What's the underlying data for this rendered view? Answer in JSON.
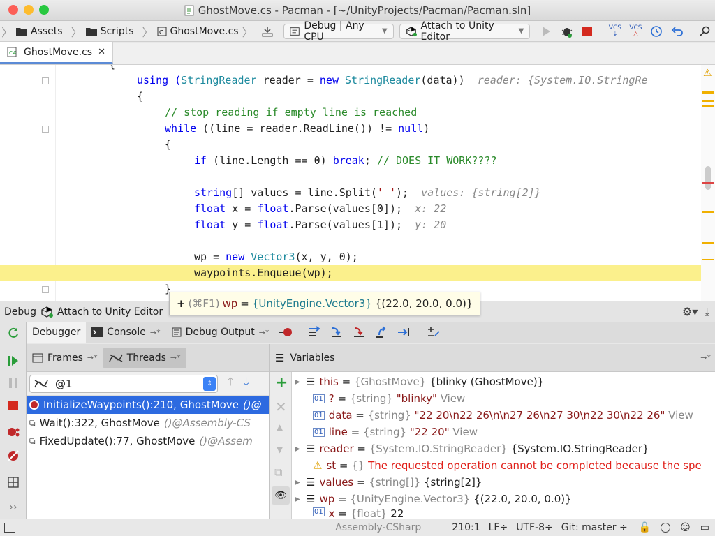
{
  "window": {
    "title": "GhostMove.cs - Pacman - [~/UnityProjects/Pacman/Pacman.sln]"
  },
  "toolbar": {
    "breadcrumbs": [
      "Assets",
      "Scripts",
      "GhostMove.cs"
    ],
    "config": "Debug | Any CPU",
    "attach": "Attach to Unity Editor",
    "vcs1": "VCS",
    "vcs2": "VCS"
  },
  "tab": {
    "label": "GhostMove.cs",
    "close": "✕"
  },
  "code": {
    "l0": "{",
    "l1a": "using (",
    "l1b": "StringReader",
    "l1c": " reader = ",
    "l1d": "new",
    "l1e": "StringReader",
    "l1f": "(data))",
    "l1hint": "reader: {System.IO.StringRe",
    "l2": "{",
    "l3": "// stop reading if empty line is reached",
    "l4a": "while",
    "l4b": " ((line = reader.ReadLine()) != ",
    "l4c": "null",
    "l4d": ")",
    "l5": "{",
    "l6a": "if",
    "l6b": " (line.Length == 0) ",
    "l6c": "break",
    "l6d": "; ",
    "l6e": "// DOES IT WORK????",
    "l7a": "string",
    "l7b": "[] values = line.Split(",
    "l7c": "' '",
    "l7d": ");",
    "l7hint": "values: {string[2]}",
    "l8a": "float",
    "l8b": " x = ",
    "l8c": "float",
    "l8d": ".Parse(values[0]);",
    "l8hint": "x: 22",
    "l9a": "float",
    "l9b": " y = ",
    "l9c": "float",
    "l9d": ".Parse(values[1]);",
    "l9hint": "y: 20",
    "l10a": "wp = ",
    "l10b": "new",
    "l10c": "Vector3",
    "l10d": "(x, y, 0);",
    "l11": "waypoints.Enqueue(wp);",
    "l12": "}"
  },
  "tooltip": {
    "plus": "+",
    "shortcut": "(⌘F1)",
    "name": "wp",
    "eq": "=",
    "type": "{UnityEngine.Vector3}",
    "value": "{(22.0, 20.0, 0.0)}"
  },
  "debugbar": {
    "label": "Debug",
    "session": "Attach to Unity Editor"
  },
  "dbgtabs": {
    "debugger": "Debugger",
    "console": "Console",
    "output": "Debug Output",
    "pin": "→*"
  },
  "frames": {
    "frames_tab": "Frames",
    "threads_tab": "Threads",
    "pin": "→*",
    "thread_select": "@1",
    "items": [
      {
        "method": "InitializeWaypoints():210, GhostMove",
        "asm": "()@"
      },
      {
        "method": "Wait():322, GhostMove",
        "asm": "()@Assembly-CS"
      },
      {
        "method": "FixedUpdate():77, GhostMove",
        "asm": "()@Assem"
      }
    ]
  },
  "variables": {
    "title": "Variables",
    "pin": "→*",
    "items": [
      {
        "name": "this",
        "eq": " = ",
        "type": "{GhostMove}",
        "value": " {blinky (GhostMove)}",
        "view": ""
      },
      {
        "name": "?",
        "eq": " = ",
        "type": "{string}",
        "value": " \"blinky\"",
        "view": " View"
      },
      {
        "name": "data",
        "eq": " = ",
        "type": "{string}",
        "value": " \"22 20\\n22 26\\n\\n27 26\\n27 30\\n22 30\\n22 26\"",
        "view": " View"
      },
      {
        "name": "line",
        "eq": " = ",
        "type": "{string}",
        "value": " \"22 20\"",
        "view": " View"
      },
      {
        "name": "reader",
        "eq": " = ",
        "type": "{System.IO.StringReader}",
        "value": " {System.IO.StringReader}",
        "view": ""
      },
      {
        "name": "st",
        "eq": " = ",
        "type": "{}",
        "value": " The requested operation cannot be completed because the spe",
        "view": ""
      },
      {
        "name": "values",
        "eq": " = ",
        "type": "{string[]}",
        "value": " {string[2]}",
        "view": ""
      },
      {
        "name": "wp",
        "eq": " = ",
        "type": "{UnityEngine.Vector3}",
        "value": " {(22.0, 20.0, 0.0)}",
        "view": ""
      },
      {
        "name": "x",
        "eq": " = ",
        "type": "{float}",
        "value": " 22",
        "view": ""
      }
    ]
  },
  "status": {
    "assembly": "Assembly-CSharp",
    "position": "210:1",
    "lineend": "LF÷",
    "encoding": "UTF-8÷",
    "git": "Git: master ÷"
  },
  "colors": {
    "accent": "#2d6ae0",
    "highlight": "#fbf08c",
    "error": "#e0201a"
  }
}
